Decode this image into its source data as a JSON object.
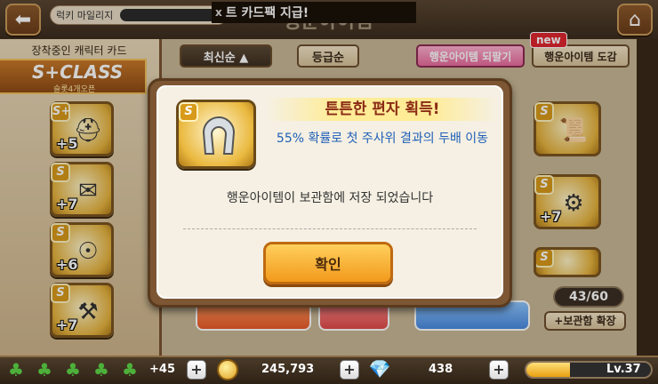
{
  "topbar": {
    "mileage_label": "럭키 마일리지",
    "ticker_prefix": "x",
    "ticker_text": "트 카드팩 지급!",
    "title": "행운아이템"
  },
  "left_panel": {
    "title": "장착중인 캐릭터 카드",
    "class_label": "S+CLASS",
    "class_sub": "슬롯4개오픈",
    "cards": [
      {
        "grade": "S+",
        "bonus": "+5",
        "icon": "helmet-icon"
      },
      {
        "grade": "S",
        "bonus": "+7",
        "icon": "ticket-icon"
      },
      {
        "grade": "S",
        "bonus": "+6",
        "icon": "compass-icon"
      },
      {
        "grade": "S",
        "bonus": "+7",
        "icon": "pliers-icon"
      }
    ]
  },
  "main": {
    "sort_newest": "최신순 ▲",
    "sort_grade": "등급순",
    "return_button": "행운아이템 되팔기",
    "collection_button": "행운아이템 도감",
    "new_badge": "new",
    "counter": "43/60",
    "expand_button": "+보관함 확장",
    "right_cards": [
      {
        "grade": "S",
        "icon": "fan-icon"
      },
      {
        "grade": "S",
        "icon": "badge-icon",
        "bonus": "+7"
      },
      {
        "grade": "S",
        "icon": "club-icon"
      }
    ]
  },
  "modal": {
    "card_grade": "S",
    "card_icon": "horseshoe-icon",
    "title": "튼튼한 편자 획득!",
    "description": "55% 확률로 첫 주사위 결과의 두배 이동",
    "message": "행운아이템이 보관함에 저장 되었습니다",
    "confirm": "확인"
  },
  "bottombar": {
    "clover_count": "+45",
    "gold": "245,793",
    "gems": "438",
    "level": "Lv.37",
    "exp_fraction": 0.35
  },
  "colors": {
    "accent_orange": "#f29a1c",
    "title_red": "#8a2a14",
    "desc_blue": "#1f5fb8",
    "pink": "#e86b9d"
  }
}
